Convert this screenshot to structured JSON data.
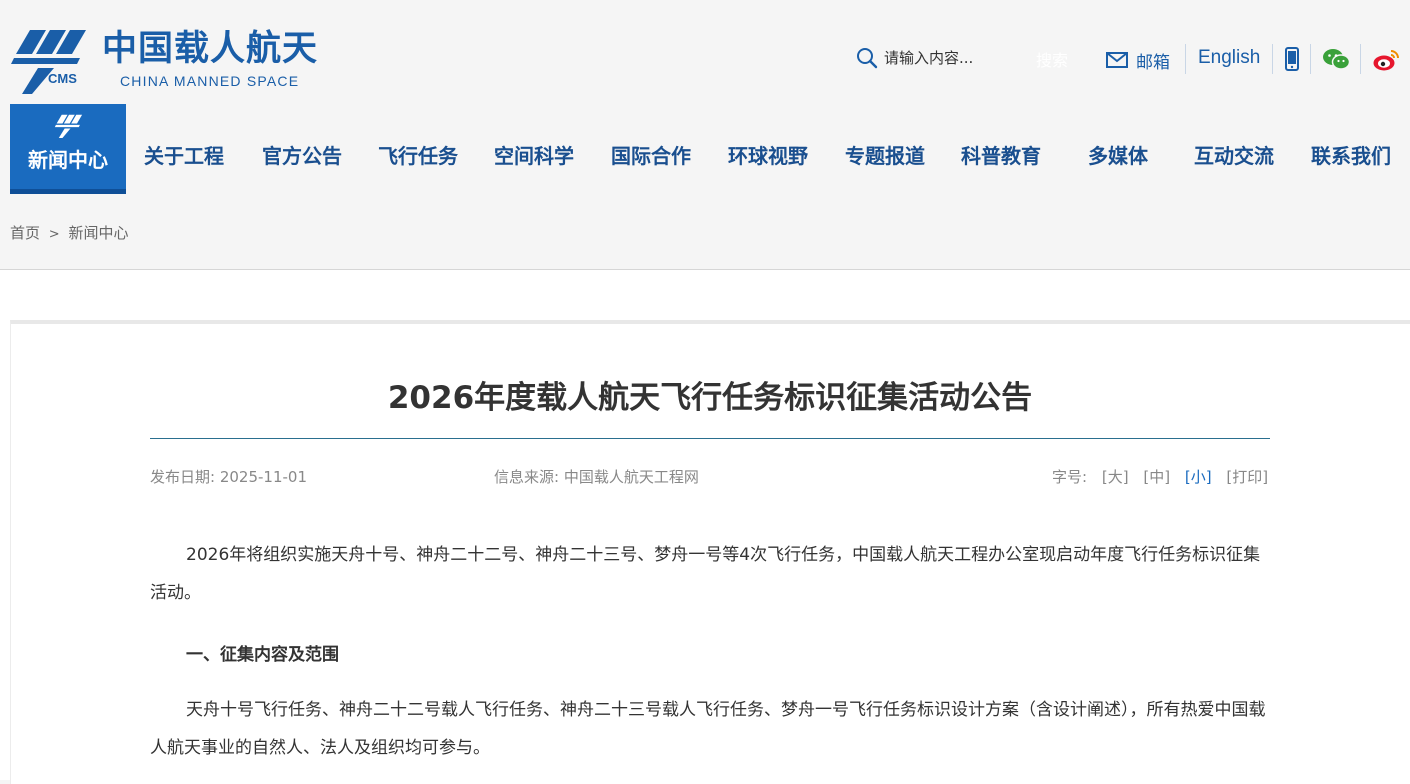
{
  "header": {
    "logo_cn": "中国载人航天",
    "logo_en": "CHINA MANNED SPACE",
    "logo_abbr": "CMS",
    "search_placeholder": "请输入内容...",
    "search_button": "搜索",
    "mail_label": "邮箱",
    "english_label": "English"
  },
  "nav": {
    "active": "新闻中心",
    "items": [
      "关于工程",
      "官方公告",
      "飞行任务",
      "空间科学",
      "国际合作",
      "环球视野",
      "专题报道",
      "科普教育",
      "多媒体",
      "互动交流",
      "联系我们"
    ]
  },
  "breadcrumb": {
    "home": "首页",
    "separator": ">",
    "current": "新闻中心"
  },
  "article": {
    "title": "2026年度载人航天飞行任务标识征集活动公告",
    "date_label": "发布日期: 2025-11-01",
    "source_label": "信息来源: 中国载人航天工程网",
    "font_size_label": "字号:",
    "font_size_options": [
      "[大]",
      "[中]",
      "[小]",
      "[打印]"
    ],
    "paragraph1": "2026年将组织实施天舟十号、神舟二十二号、神舟二十三号、梦舟一号等4次飞行任务，中国载人航天工程办公室现启动年度飞行任务标识征集活动。",
    "section1_heading": "一、征集内容及范围",
    "paragraph2": "天舟十号飞行任务、神舟二十二号载人飞行任务、神舟二十三号载人飞行任务、梦舟一号飞行任务标识设计方案（含设计阐述），所有热爱中国载人航天事业的自然人、法人及组织均可参与。"
  },
  "colors": {
    "brand_blue": "#1a5ea8",
    "nav_active_bg": "#1a6bbf",
    "page_bg": "#f5f5f5"
  }
}
